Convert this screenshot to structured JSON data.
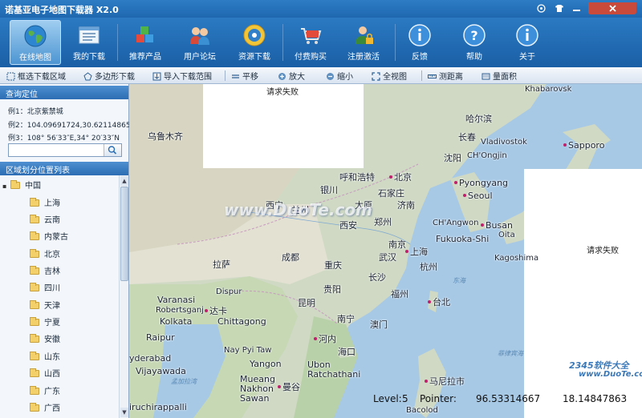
{
  "window": {
    "title": "诺基亚电子地图下载器 X2.0",
    "controls": [
      "target-icon",
      "shirt-icon",
      "minimize-icon",
      "close-icon"
    ]
  },
  "toolbar": {
    "items": [
      {
        "label": "在线地图",
        "icon": "globe-icon",
        "active": true
      },
      {
        "label": "我的下载",
        "icon": "list-window-icon",
        "active": false
      },
      {
        "label": "推荐产品",
        "icon": "cubes-icon",
        "active": false
      },
      {
        "label": "用户论坛",
        "icon": "users-icon",
        "active": false
      },
      {
        "label": "资源下载",
        "icon": "disc-icon",
        "active": false
      },
      {
        "label": "付费购买",
        "icon": "cart-icon",
        "active": false
      },
      {
        "label": "注册激活",
        "icon": "lock-user-icon",
        "active": false
      },
      {
        "label": "反馈",
        "icon": "info-icon",
        "active": false
      },
      {
        "label": "帮助",
        "icon": "help-icon",
        "active": false
      },
      {
        "label": "关于",
        "icon": "info-icon",
        "active": false
      }
    ]
  },
  "maptools": {
    "items": [
      {
        "label": "框选下载区域",
        "icon": "select-icon"
      },
      {
        "label": "多边形下载",
        "icon": "polygon-icon"
      },
      {
        "label": "导入下载范围",
        "icon": "import-icon"
      },
      {
        "label": "平移",
        "icon": "pan-icon"
      },
      {
        "label": "放大",
        "icon": "zoom-in-icon"
      },
      {
        "label": "缩小",
        "icon": "zoom-out-icon"
      },
      {
        "label": "全视图",
        "icon": "full-view-icon"
      },
      {
        "label": "测距离",
        "icon": "ruler-icon"
      },
      {
        "label": "量面积",
        "icon": "area-icon"
      }
    ]
  },
  "query": {
    "header": "查询定位",
    "examples": [
      "例1：北京紫禁城",
      "例2：104.09691724,30.62114865",
      "例3：108° 56′33″E,34° 20′33″N"
    ],
    "search_value": "",
    "search_icon": "search-icon"
  },
  "regions": {
    "header": "区域划分位置列表",
    "root": "中国",
    "items": [
      "上海",
      "云南",
      "内蒙古",
      "北京",
      "吉林",
      "四川",
      "天津",
      "宁夏",
      "安徽",
      "山东",
      "山西",
      "广东",
      "广西"
    ]
  },
  "map": {
    "fail_text": "请求失败",
    "cities": [
      "Khabarovsk",
      "哈尔滨",
      "长春",
      "Vladivostok",
      "沈阳",
      "CH'Ongjin",
      "Sapporo",
      "乌鲁木齐",
      "呼和浩特",
      "北京",
      "银川",
      "石家庄",
      "Pyongyang",
      "Seoul",
      "西宁",
      "兰州",
      "太原",
      "济南",
      "郑州",
      "西安",
      "CH'Angwon",
      "Busan",
      "Fukuoka-Shi",
      "Oita",
      "南京",
      "上海",
      "成都",
      "重庆",
      "武汉",
      "杭州",
      "Kagoshima",
      "拉萨",
      "长沙",
      "Dispur",
      "贵阳",
      "福州",
      "昆明",
      "Varanasi",
      "Robertsganj",
      "达卡",
      "Kolkata",
      "Chittagong",
      "台北",
      "南宁",
      "澳门",
      "Raipur",
      "Nay Pyi Taw",
      "河内",
      "海口",
      "yderabad",
      "Vijayawada",
      "Yangon",
      "Ubon Ratchathani",
      "马尼拉市",
      "Mueang Nakhon Sawan",
      "曼谷",
      "iruchirappalli",
      "Bacolod"
    ],
    "seas": [
      "东海",
      "孟加拉湾",
      "菲律宾海"
    ],
    "status": {
      "level_label": "Level:",
      "level_value": "5",
      "pointer_label": "Pointer:",
      "lon": "96.53314667",
      "lat": "18.14847863"
    }
  },
  "watermark": {
    "main": "www.DuoTe.com",
    "site": "2345软件大全",
    "site_url": "www.DuoTe.com",
    "sub": "国内最安全的软件站"
  },
  "colors": {
    "titlebar": "#1f68b0",
    "accent": "#2c6db3",
    "city_dot": "#c0206b"
  }
}
